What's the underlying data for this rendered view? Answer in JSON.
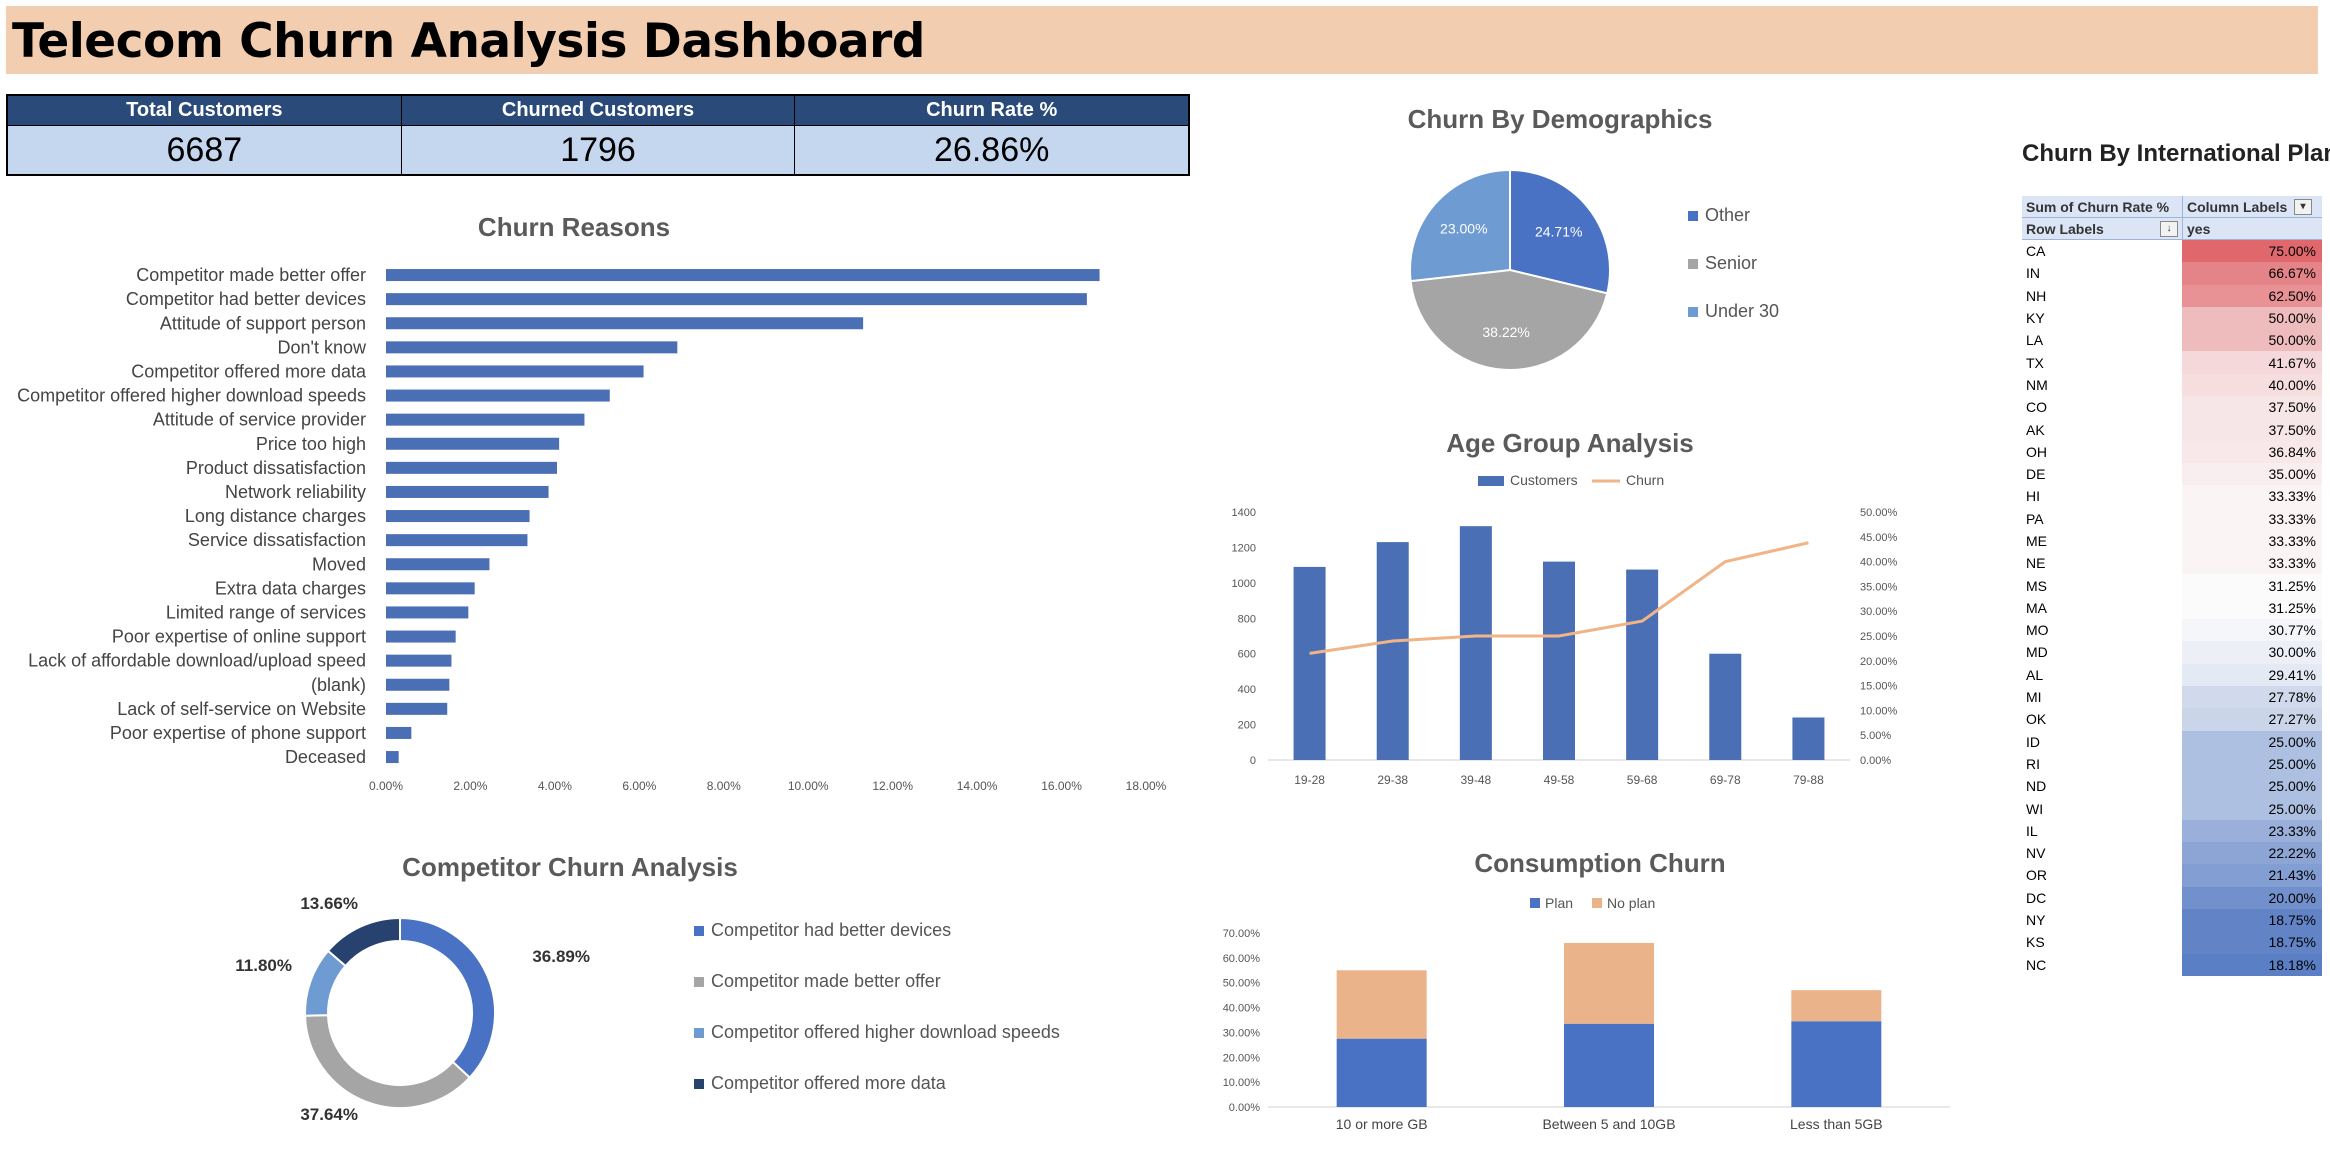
{
  "title": "Telecom Churn Analysis Dashboard",
  "kpis": [
    {
      "label": "Total Customers",
      "value": "6687"
    },
    {
      "label": "Churned Customers",
      "value": "1796"
    },
    {
      "label": "Churn Rate %",
      "value": "26.86%"
    }
  ],
  "chart_data": [
    {
      "id": "churn-reasons",
      "type": "bar",
      "orientation": "horizontal",
      "title": "Churn Reasons",
      "categories": [
        "Competitor made better offer",
        "Competitor had better devices",
        "Attitude of support person",
        "Don't know",
        "Competitor offered more data",
        "Competitor offered higher download speeds",
        "Attitude of service provider",
        "Price too high",
        "Product dissatisfaction",
        "Network reliability",
        "Long distance charges",
        "Service dissatisfaction",
        "Moved",
        "Extra data charges",
        "Limited range of services",
        "Poor expertise of online support",
        "Lack of affordable download/upload speed",
        "(blank)",
        "Lack of self-service on Website",
        "Poor expertise of phone support",
        "Deceased"
      ],
      "values": [
        16.9,
        16.6,
        11.3,
        6.9,
        6.1,
        5.3,
        4.7,
        4.1,
        4.05,
        3.85,
        3.4,
        3.35,
        2.45,
        2.1,
        1.95,
        1.65,
        1.55,
        1.5,
        1.45,
        0.6,
        0.3
      ],
      "xlim": [
        0,
        18
      ],
      "ticks": [
        "0.00%",
        "2.00%",
        "4.00%",
        "6.00%",
        "8.00%",
        "10.00%",
        "12.00%",
        "14.00%",
        "16.00%",
        "18.00%"
      ],
      "color": "#4a6fb5"
    },
    {
      "id": "churn-demographics",
      "type": "pie",
      "title": "Churn By Demographics",
      "labels": [
        "Other",
        "Senior",
        "Under 30"
      ],
      "values": [
        24.71,
        38.22,
        23.0
      ],
      "display": [
        "24.71%",
        "38.22%",
        "23.00%"
      ],
      "colors": [
        "#4a72c4",
        "#a5a5a5",
        "#6d9bd2"
      ]
    },
    {
      "id": "age-group",
      "type": "bar",
      "title": "Age Group Analysis",
      "categories": [
        "19-28",
        "29-38",
        "39-48",
        "49-58",
        "59-68",
        "69-78",
        "79-88"
      ],
      "series": [
        {
          "name": "Customers",
          "kind": "bar",
          "values": [
            1090,
            1230,
            1320,
            1120,
            1075,
            600,
            240
          ],
          "color": "#4a6fb5"
        },
        {
          "name": "Churn",
          "kind": "line",
          "values": [
            21.5,
            24.0,
            25.0,
            25.0,
            28.0,
            40.0,
            43.8
          ],
          "color": "#f0b487"
        }
      ],
      "ylim": [
        0,
        1400
      ],
      "y2lim": [
        0,
        50
      ],
      "yticks": [
        "0",
        "200",
        "400",
        "600",
        "800",
        "1000",
        "1200",
        "1400"
      ],
      "y2ticks": [
        "0.00%",
        "5.00%",
        "10.00%",
        "15.00%",
        "20.00%",
        "25.00%",
        "30.00%",
        "35.00%",
        "40.00%",
        "45.00%",
        "50.00%"
      ]
    },
    {
      "id": "competitor-churn",
      "type": "pie",
      "subtype": "donut",
      "title": "Competitor Churn Analysis",
      "labels": [
        "Competitor had better devices",
        "Competitor made better offer",
        "Competitor offered higher download speeds",
        "Competitor offered more data"
      ],
      "values": [
        36.89,
        37.64,
        11.8,
        13.66
      ],
      "display": [
        "36.89%",
        "37.64%",
        "11.80%",
        "13.66%"
      ],
      "colors": [
        "#4a72c4",
        "#a5a5a5",
        "#6d9bd2",
        "#27426f"
      ]
    },
    {
      "id": "consumption-churn",
      "type": "bar",
      "stacked": true,
      "title": "Consumption Churn",
      "categories": [
        "10 or more GB",
        "Between 5 and 10GB",
        "Less than 5GB"
      ],
      "series": [
        {
          "name": "Plan",
          "values": [
            27.5,
            33.5,
            34.5
          ],
          "color": "#4a72c4"
        },
        {
          "name": "No plan",
          "values": [
            27.5,
            32.5,
            12.5
          ],
          "color": "#ebb38a"
        }
      ],
      "ylim": [
        0,
        70
      ],
      "yticks": [
        "0.00%",
        "10.00%",
        "20.00%",
        "30.00%",
        "40.00%",
        "50.00%",
        "60.00%",
        "70.00%"
      ]
    },
    {
      "id": "intl-plan",
      "type": "table",
      "title": "Churn By International Plan",
      "header": {
        "values_label": "Sum of Churn Rate %",
        "columns_label": "Column Labels",
        "rows_label": "Row Labels",
        "column": "yes"
      },
      "rows": [
        {
          "state": "CA",
          "value": "75.00%",
          "v": 75.0
        },
        {
          "state": "IN",
          "value": "66.67%",
          "v": 66.67
        },
        {
          "state": "NH",
          "value": "62.50%",
          "v": 62.5
        },
        {
          "state": "KY",
          "value": "50.00%",
          "v": 50.0
        },
        {
          "state": "LA",
          "value": "50.00%",
          "v": 50.0
        },
        {
          "state": "TX",
          "value": "41.67%",
          "v": 41.67
        },
        {
          "state": "NM",
          "value": "40.00%",
          "v": 40.0
        },
        {
          "state": "CO",
          "value": "37.50%",
          "v": 37.5
        },
        {
          "state": "AK",
          "value": "37.50%",
          "v": 37.5
        },
        {
          "state": "OH",
          "value": "36.84%",
          "v": 36.84
        },
        {
          "state": "DE",
          "value": "35.00%",
          "v": 35.0
        },
        {
          "state": "HI",
          "value": "33.33%",
          "v": 33.33
        },
        {
          "state": "PA",
          "value": "33.33%",
          "v": 33.33
        },
        {
          "state": "ME",
          "value": "33.33%",
          "v": 33.33
        },
        {
          "state": "NE",
          "value": "33.33%",
          "v": 33.33
        },
        {
          "state": "MS",
          "value": "31.25%",
          "v": 31.25
        },
        {
          "state": "MA",
          "value": "31.25%",
          "v": 31.25
        },
        {
          "state": "MO",
          "value": "30.77%",
          "v": 30.77
        },
        {
          "state": "MD",
          "value": "30.00%",
          "v": 30.0
        },
        {
          "state": "AL",
          "value": "29.41%",
          "v": 29.41
        },
        {
          "state": "MI",
          "value": "27.78%",
          "v": 27.78
        },
        {
          "state": "OK",
          "value": "27.27%",
          "v": 27.27
        },
        {
          "state": "ID",
          "value": "25.00%",
          "v": 25.0
        },
        {
          "state": "RI",
          "value": "25.00%",
          "v": 25.0
        },
        {
          "state": "ND",
          "value": "25.00%",
          "v": 25.0
        },
        {
          "state": "WI",
          "value": "25.00%",
          "v": 25.0
        },
        {
          "state": "IL",
          "value": "23.33%",
          "v": 23.33
        },
        {
          "state": "NV",
          "value": "22.22%",
          "v": 22.22
        },
        {
          "state": "OR",
          "value": "21.43%",
          "v": 21.43
        },
        {
          "state": "DC",
          "value": "20.00%",
          "v": 20.0
        },
        {
          "state": "NY",
          "value": "18.75%",
          "v": 18.75
        },
        {
          "state": "KS",
          "value": "18.75%",
          "v": 18.75
        },
        {
          "state": "NC",
          "value": "18.18%",
          "v": 18.18
        }
      ],
      "scale": {
        "low_color": "#5b7fc4",
        "mid_color": "#fbfbfb",
        "high_color": "#e0686d",
        "mid_value": 31.25
      }
    }
  ]
}
